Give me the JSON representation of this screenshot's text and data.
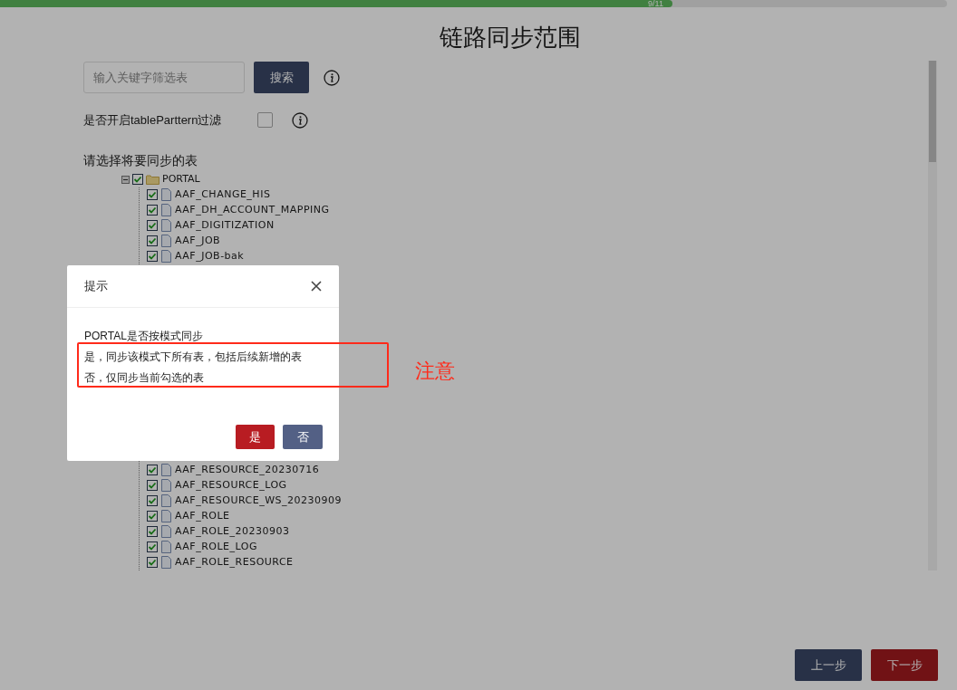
{
  "progress": {
    "label": "9/11",
    "level": 0.71
  },
  "title": "链路同步范围",
  "search": {
    "placeholder": "输入关键字筛选表",
    "button": "搜索"
  },
  "pattern_filter": {
    "label": "是否开启tableParttern过滤",
    "checked": false
  },
  "tree_label": "请选择将要同步的表",
  "tree": {
    "label": "PORTAL",
    "expanded": true,
    "checked": true,
    "children_top": [
      {
        "label": "AAF_CHANGE_HIS",
        "checked": true
      },
      {
        "label": "AAF_DH_ACCOUNT_MAPPING",
        "checked": true
      },
      {
        "label": "AAF_DIGITIZATION",
        "checked": true
      },
      {
        "label": "AAF_JOB",
        "checked": true
      },
      {
        "label": "AAF_JOB-bak",
        "checked": true
      }
    ],
    "children_bottom": [
      {
        "label": "AAF_RESOURCE_20230716",
        "checked": true
      },
      {
        "label": "AAF_RESOURCE_LOG",
        "checked": true
      },
      {
        "label": "AAF_RESOURCE_WS_20230909",
        "checked": true
      },
      {
        "label": "AAF_ROLE",
        "checked": true
      },
      {
        "label": "AAF_ROLE_20230903",
        "checked": true
      },
      {
        "label": "AAF_ROLE_LOG",
        "checked": true
      },
      {
        "label": "AAF_ROLE_RESOURCE",
        "checked": true
      }
    ]
  },
  "footer": {
    "prev": "上一步",
    "next": "下一步"
  },
  "dialog": {
    "title": "提示",
    "lines": [
      "PORTAL是否按模式同步",
      "是，同步该模式下所有表，包括后续新增的表",
      "否，仅同步当前勾选的表"
    ],
    "yes": "是",
    "no": "否"
  },
  "annotation": "注意"
}
